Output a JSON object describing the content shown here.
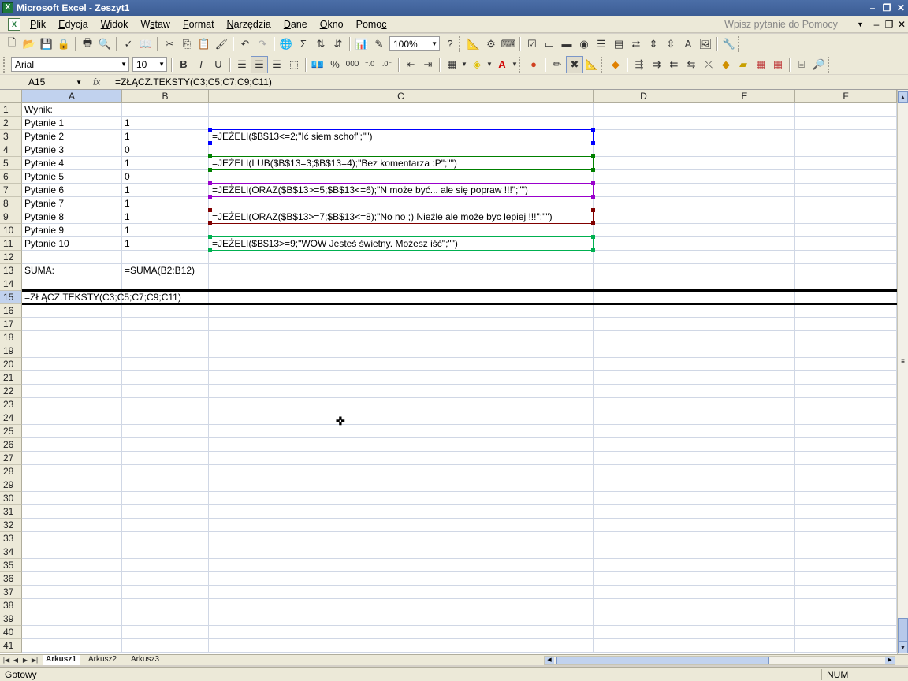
{
  "window": {
    "title": "Microsoft Excel - Zeszyt1",
    "app_icon": "excel-icon"
  },
  "menu": {
    "items": [
      {
        "pre": "",
        "u": "P",
        "post": "lik"
      },
      {
        "pre": "",
        "u": "E",
        "post": "dycja"
      },
      {
        "pre": "",
        "u": "W",
        "post": "idok"
      },
      {
        "pre": "W",
        "u": "s",
        "post": "taw"
      },
      {
        "pre": "",
        "u": "F",
        "post": "ormat"
      },
      {
        "pre": "",
        "u": "N",
        "post": "arzędzia"
      },
      {
        "pre": "",
        "u": "D",
        "post": "ane"
      },
      {
        "pre": "",
        "u": "O",
        "post": "kno"
      },
      {
        "pre": "Pomo",
        "u": "c",
        "post": ""
      }
    ],
    "help_placeholder": "Wpisz pytanie do Pomocy"
  },
  "toolbar": {
    "zoom": "100%",
    "font": "Arial",
    "font_size": "10",
    "bold": "B",
    "italic": "I",
    "underline": "U"
  },
  "formula_bar": {
    "name_box": "A15",
    "fx": "fx",
    "formula": "=ZŁĄCZ.TEKSTY(C3;C5;C7;C9;C11)"
  },
  "columns": [
    "A",
    "B",
    "C",
    "D",
    "E",
    "F"
  ],
  "cells": {
    "A1": "Wynik:",
    "A2": "Pytanie 1",
    "B2": "1",
    "A3": "Pytanie 2",
    "B3": "1",
    "A4": "Pytanie 3",
    "B4": "0",
    "A5": "Pytanie 4",
    "B5": "1",
    "A6": "Pytanie 5",
    "B6": "0",
    "A7": "Pytanie 6",
    "B7": "1",
    "A8": "Pytanie 7",
    "B8": "1",
    "A9": "Pytanie 8",
    "B9": "1",
    "A10": "Pytanie 9",
    "B10": "1",
    "A11": "Pytanie 10",
    "B11": "1",
    "A13": "SUMA:",
    "B13": "=SUMA(B2:B12)",
    "A15": "=ZŁĄCZ.TEKSTY(C3;C5;C7;C9;C11)"
  },
  "formula_cells": [
    {
      "ref": "C3",
      "text": "=JEŻELI($B$13<=2;\"Ić siem schof\";\"\")",
      "color": "#0000ff"
    },
    {
      "ref": "C5",
      "text": "=JEŻELI(LUB($B$13=3;$B$13=4);\"Bez komentarza :P\";\"\")",
      "color": "#008000"
    },
    {
      "ref": "C7",
      "text": "=JEŻELI(ORAZ($B$13>=5;$B$13<=6);\"N może być... ale się popraw !!!\";\"\")",
      "color": "#9900cc"
    },
    {
      "ref": "C9",
      "text": "=JEŻELI(ORAZ($B$13>=7;$B$13<=8);\"No no ;) Nieźle ale może byc lepiej !!!\";\"\")",
      "color": "#800000"
    },
    {
      "ref": "C11",
      "text": "=JEŻELI($B$13>=9;\"WOW Jesteś świetny. Możesz iść\";\"\")",
      "color": "#00b050"
    }
  ],
  "sheets": [
    "Arkusz1",
    "Arkusz2",
    "Arkusz3"
  ],
  "status": {
    "ready": "Gotowy",
    "num": "NUM"
  }
}
